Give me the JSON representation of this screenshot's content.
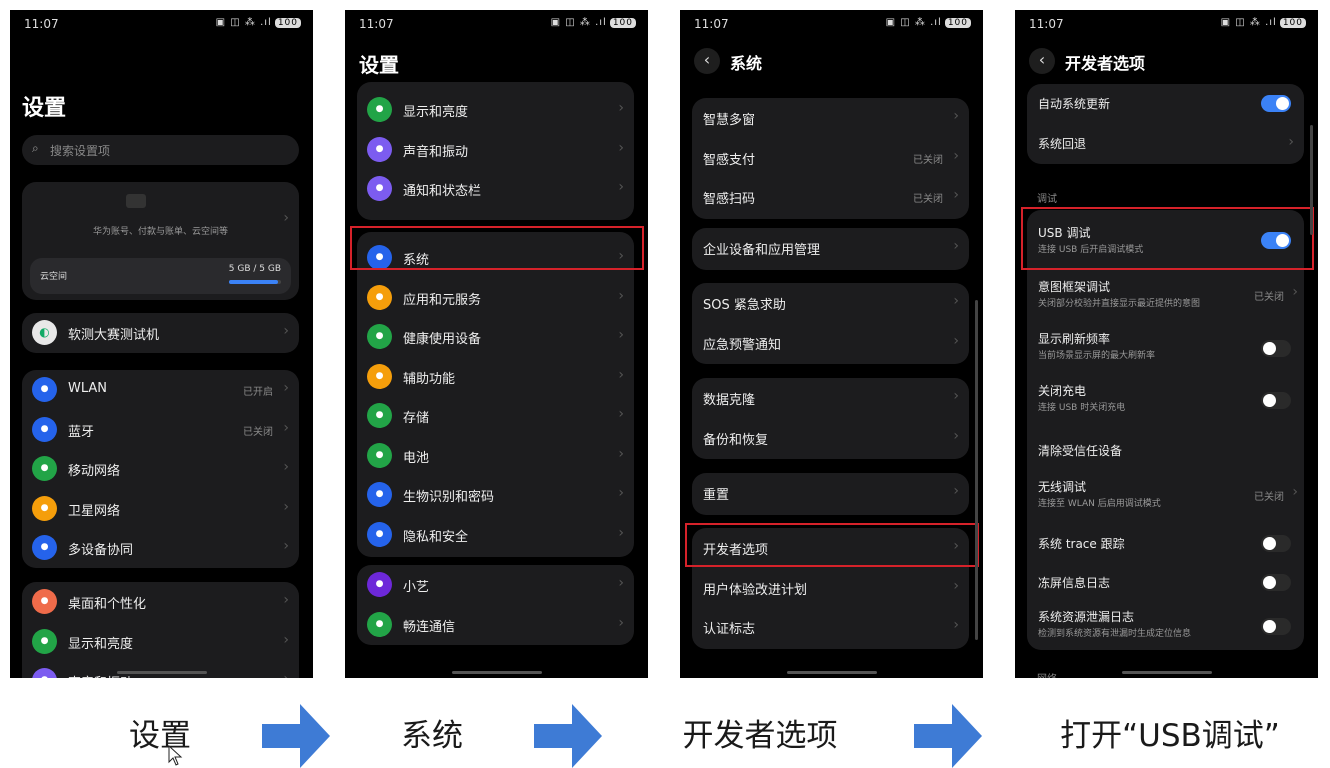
{
  "status": {
    "time": "11:07",
    "battery": "100"
  },
  "screen1": {
    "title": "设置",
    "search_placeholder": "搜索设置项",
    "account": {
      "name": "华为账号、付款与账单、云空间等",
      "storage_label": "云空间",
      "storage_value": "5 GB / 5 GB",
      "storage_fill": 0.95
    },
    "device": "软测大赛测试机",
    "conn": [
      {
        "label": "WLAN",
        "value": "已开启",
        "icon": "wifi-icon",
        "color": "#2563eb"
      },
      {
        "label": "蓝牙",
        "value": "已关闭",
        "icon": "bluetooth-icon",
        "color": "#2563eb"
      },
      {
        "label": "移动网络",
        "value": "",
        "icon": "mobile-data-icon",
        "color": "#22a447"
      },
      {
        "label": "卫星网络",
        "value": "",
        "icon": "satellite-icon",
        "color": "#f59e0b"
      },
      {
        "label": "多设备协同",
        "value": "",
        "icon": "multi-device-icon",
        "color": "#2563eb"
      }
    ],
    "more": [
      {
        "label": "桌面和个性化",
        "icon": "palette-icon",
        "color": "#ef6b4a"
      },
      {
        "label": "显示和亮度",
        "icon": "display-icon",
        "color": "#22a447"
      },
      {
        "label": "声音和振动",
        "icon": "sound-icon",
        "color": "#7c5cf0"
      }
    ]
  },
  "screen2": {
    "title": "设置",
    "group1": [
      {
        "label": "显示和亮度",
        "icon": "display-icon",
        "color": "#22a447"
      },
      {
        "label": "声音和振动",
        "icon": "sound-icon",
        "color": "#7c5cf0"
      },
      {
        "label": "通知和状态栏",
        "icon": "bell-icon",
        "color": "#7c5cf0"
      }
    ],
    "group2": [
      {
        "label": "系统",
        "icon": "gear-icon",
        "color": "#2563eb"
      },
      {
        "label": "应用和元服务",
        "icon": "apps-icon",
        "color": "#f59e0b"
      },
      {
        "label": "健康使用设备",
        "icon": "hourglass-icon",
        "color": "#22a447"
      },
      {
        "label": "辅助功能",
        "icon": "accessibility-icon",
        "color": "#f59e0b"
      },
      {
        "label": "存储",
        "icon": "storage-icon",
        "color": "#22a447"
      },
      {
        "label": "电池",
        "icon": "battery-icon",
        "color": "#22a447"
      },
      {
        "label": "生物识别和密码",
        "icon": "key-icon",
        "color": "#2563eb"
      },
      {
        "label": "隐私和安全",
        "icon": "shield-icon",
        "color": "#2563eb"
      }
    ],
    "group3": [
      {
        "label": "小艺",
        "icon": "assistant-icon",
        "color": "#6d28d9"
      },
      {
        "label": "畅连通信",
        "icon": "call-icon",
        "color": "#22a447"
      }
    ]
  },
  "screen3": {
    "back_title": "系统",
    "groups": [
      [
        {
          "label": "智慧多窗",
          "value": ""
        },
        {
          "label": "智感支付",
          "value": "已关闭"
        },
        {
          "label": "智感扫码",
          "value": "已关闭"
        }
      ],
      [
        {
          "label": "企业设备和应用管理",
          "value": ""
        }
      ],
      [
        {
          "label": "SOS 紧急求助",
          "value": ""
        },
        {
          "label": "应急预警通知",
          "value": ""
        }
      ],
      [
        {
          "label": "数据克隆",
          "value": ""
        },
        {
          "label": "备份和恢复",
          "value": ""
        }
      ],
      [
        {
          "label": "重置",
          "value": ""
        }
      ],
      [
        {
          "label": "开发者选项",
          "value": ""
        },
        {
          "label": "用户体验改进计划",
          "value": ""
        },
        {
          "label": "认证标志",
          "value": ""
        }
      ]
    ]
  },
  "screen4": {
    "back_title": "开发者选项",
    "auto_update": {
      "label": "自动系统更新",
      "on": true
    },
    "rollback": "系统回退",
    "section": "调试",
    "usb": {
      "label": "USB 调试",
      "sub": "连接 USB 后开启调试模式",
      "on": true
    },
    "intent": {
      "label": "意图框架调试",
      "sub": "关闭部分校验并直接显示最近提供的意图",
      "value": "已关闭"
    },
    "refresh": {
      "label": "显示刷新频率",
      "sub": "当前场景显示屏的最大刷新率",
      "on": false
    },
    "charge": {
      "label": "关闭充电",
      "sub": "连接 USB 时关闭充电",
      "on": false
    },
    "revoke": "清除受信任设备",
    "wireless": {
      "label": "无线调试",
      "sub": "连接至 WLAN 后启用调试模式",
      "value": "已关闭"
    },
    "trace": {
      "label": "系统 trace 跟踪",
      "on": false
    },
    "freeze": {
      "label": "冻屏信息日志",
      "on": false
    },
    "leak": {
      "label": "系统资源泄漏日志",
      "sub": "检测到系统资源有泄漏时生成定位信息",
      "on": false
    },
    "next_section": "网络"
  },
  "captions": [
    "设置",
    "系统",
    "开发者选项",
    "打开“USB调试”"
  ],
  "colors": {
    "highlight": "#d6222a",
    "arrow": "#3e7bd5",
    "toggle_on": "#3b82f6"
  }
}
